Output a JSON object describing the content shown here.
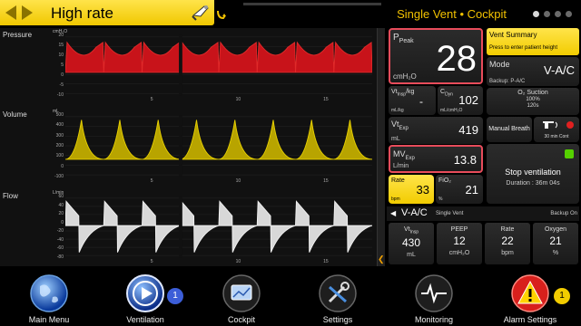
{
  "alarm": {
    "text": "High rate"
  },
  "header": {
    "title": "Single Vent • Cockpit",
    "page_count": 4,
    "active_page": 1
  },
  "waveforms": [
    {
      "label": "Pressure",
      "unit": "cmH₂O",
      "scale": [
        "20",
        "15",
        "10",
        "5",
        "0",
        "-5",
        "-10"
      ],
      "color": "#c8131a",
      "stroke": "#e02a2a"
    },
    {
      "label": "Volume",
      "unit": "mL",
      "scale": [
        "500",
        "400",
        "300",
        "200",
        "100",
        "0",
        "-100"
      ],
      "color": "#b8a400",
      "stroke": "#e6cf00"
    },
    {
      "label": "Flow",
      "unit": "L/min",
      "scale": [
        "60",
        "40",
        "20",
        "0",
        "-20",
        "-40",
        "-60",
        "-80"
      ],
      "color": "#d8d8d8",
      "stroke": "#f0f0f0"
    }
  ],
  "time_axis": [
    "5",
    "10",
    "15"
  ],
  "ppeak": {
    "label": "P",
    "label_sub": "Peak",
    "value": "28",
    "unit": "cmH₂O"
  },
  "vt_kg": {
    "label": "Vt",
    "label_sub": "Insp",
    "label_suffix": "/kg",
    "value": "-",
    "unit": "mL/kg"
  },
  "cdyn": {
    "label": "C",
    "label_sub": "Dyn",
    "value": "102",
    "unit": "mL/cmH₂O"
  },
  "vte": {
    "label": "Vt",
    "label_sub": "Exp",
    "value": "419",
    "unit": "mL"
  },
  "mve": {
    "label": "MV",
    "label_sub": "Exp",
    "value": "13.8",
    "unit": "L/min"
  },
  "rate_tile": {
    "label": "Rate",
    "value": "33",
    "unit": "bpm"
  },
  "fio2_tile": {
    "label": "FiO₂",
    "value": "21",
    "unit": "%"
  },
  "vent_summary": {
    "title": "Vent Summary",
    "subtitle": "Press to enter patient height"
  },
  "mode": {
    "label": "Mode",
    "value": "V-A/C",
    "backup": "Backup: P-A/C"
  },
  "o2_suction": {
    "label": "O₂ Suction",
    "pct": "100%",
    "time": "120s"
  },
  "manual_breath": {
    "label": "Manual Breath"
  },
  "cont_30": {
    "label": "30 min Cont"
  },
  "stop_vent": {
    "label": "Stop ventilation",
    "duration": "Duration :  36m 04s"
  },
  "mode_bar": {
    "mode": "V-A/C",
    "sub": "Single Vent",
    "backup": "Backup On"
  },
  "settings": [
    {
      "label": "Vt",
      "label_sub": "Insp",
      "value": "430",
      "unit": "mL"
    },
    {
      "label": "PEEP",
      "label_sub": "",
      "value": "12",
      "unit": "cmH₂O"
    },
    {
      "label": "Rate",
      "label_sub": "",
      "value": "22",
      "unit": "bpm"
    },
    {
      "label": "Oxygen",
      "label_sub": "",
      "value": "21",
      "unit": "%"
    }
  ],
  "dock": [
    {
      "label": "Main Menu",
      "icon": "globe-icon"
    },
    {
      "label": "Ventilation",
      "icon": "play-icon",
      "badge": "1"
    },
    {
      "label": "Cockpit",
      "icon": "cockpit-icon"
    },
    {
      "label": "Settings",
      "icon": "tools-icon"
    },
    {
      "label": "Monitoring",
      "icon": "waveform-icon"
    },
    {
      "label": "Alarm Settings",
      "icon": "warning-icon",
      "badge": "1"
    }
  ]
}
